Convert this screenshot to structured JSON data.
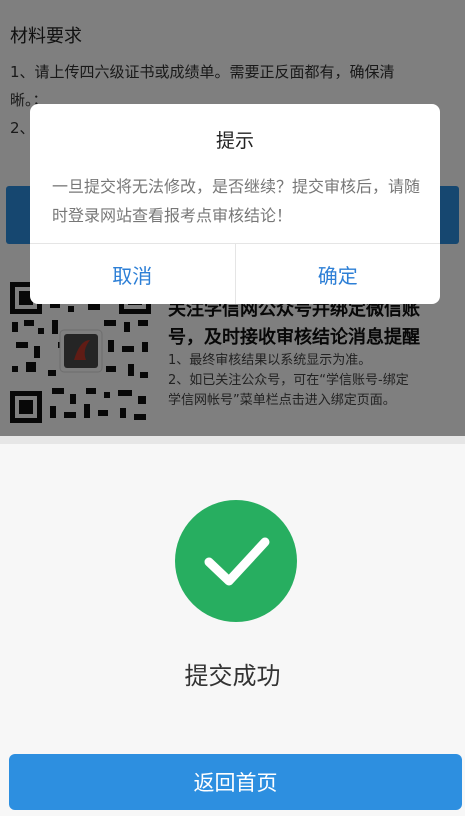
{
  "materials": {
    "title": "材料要求",
    "items": [
      "1、请上传四六级证书或成绩单。需要正反面都有，确保清",
      "晰。；",
      "2、"
    ]
  },
  "follow": {
    "title_line1": "关注学信网公众号并绑定微信账",
    "title_line2": "号，及时接收审核结论消息提醒",
    "note1": "1、最终审核结果以系统显示为准。",
    "note2_line1": "2、如已关注公众号，可在“学信账号-绑定",
    "note2_line2": "学信网帐号”菜单栏点击进入绑定页面。"
  },
  "dialog": {
    "title": "提示",
    "message": "一旦提交将无法修改，是否继续？提交审核后，请随时登录网站查看报考点审核结论！",
    "cancel": "取消",
    "confirm": "确定"
  },
  "result": {
    "status": "提交成功",
    "home_button": "返回首页"
  },
  "colors": {
    "accent": "#2d8fe0",
    "success": "#27ae60",
    "dialog_button": "#2d7fd6"
  },
  "icons": [
    "qr-code-icon",
    "check-icon"
  ]
}
